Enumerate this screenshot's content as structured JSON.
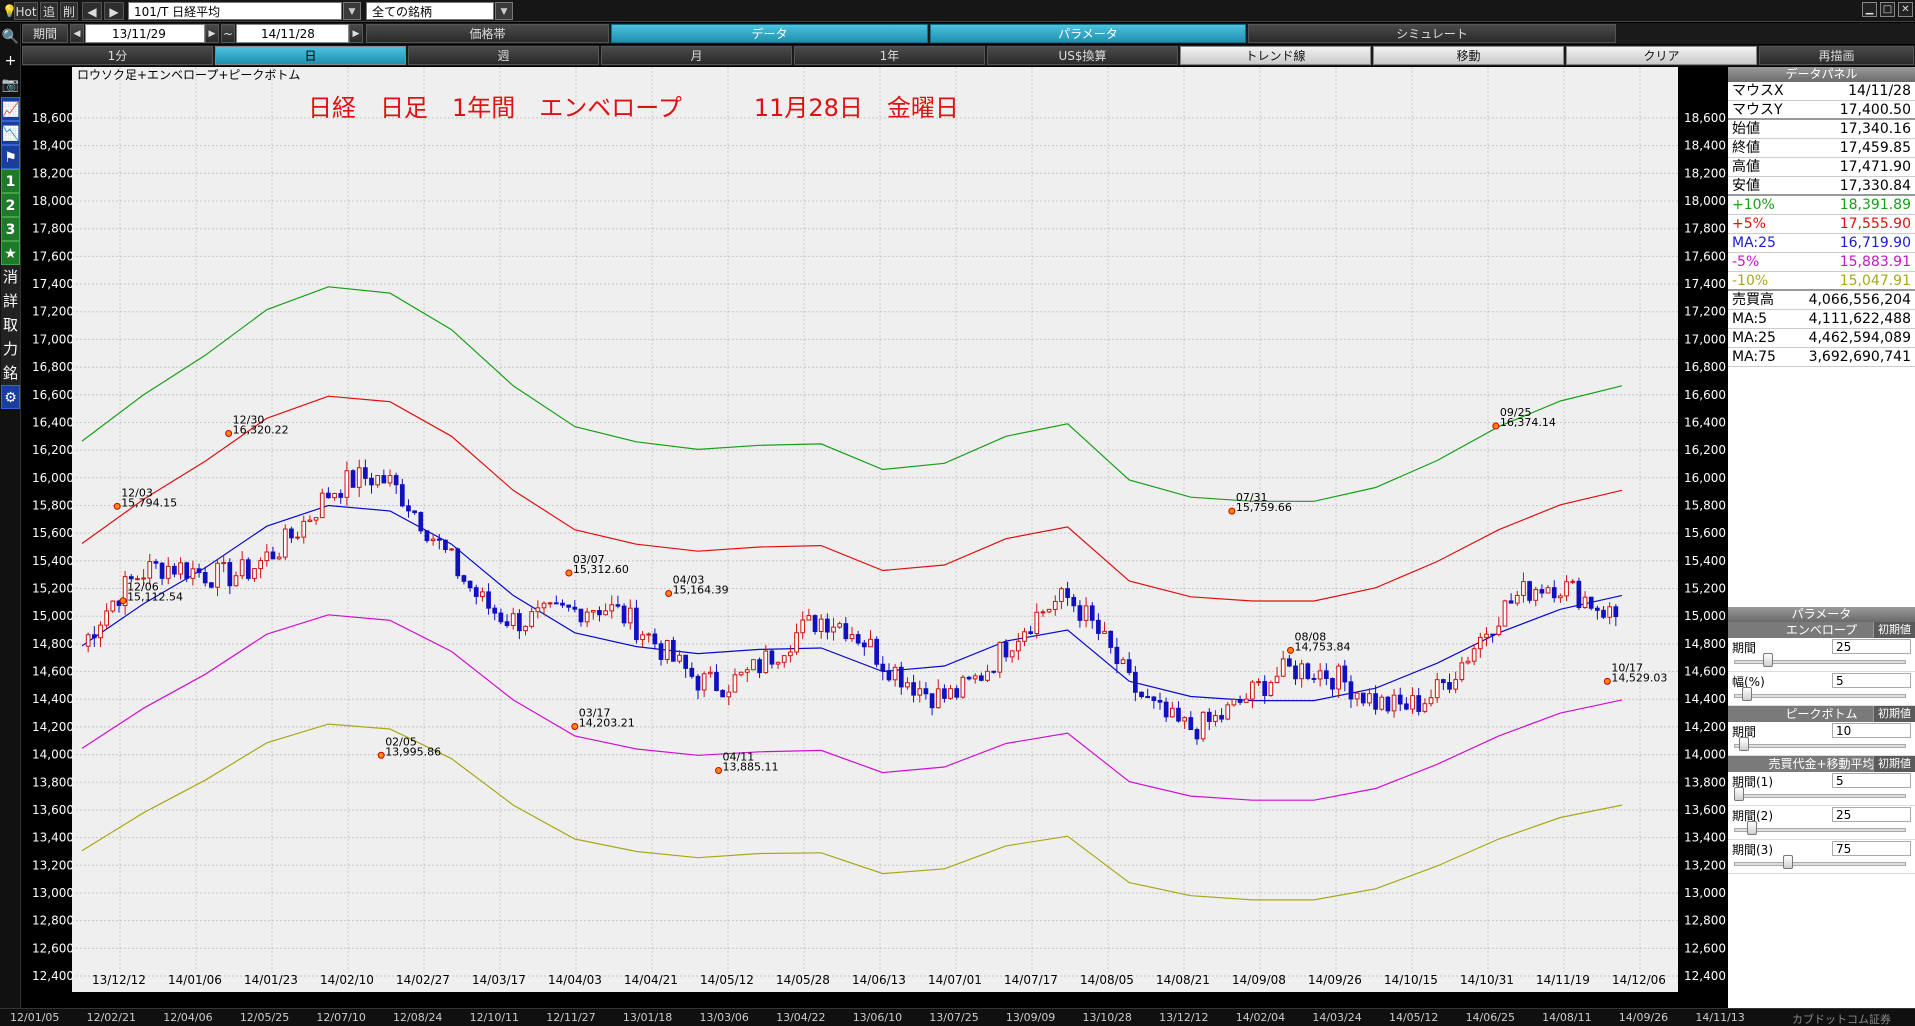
{
  "topbar": {
    "hot": "Hot",
    "tsui": "追",
    "sakujo": "削",
    "code": "101/T 日経平均",
    "market": "全ての銘柄"
  },
  "period": {
    "label": "期間",
    "start": "13/11/29",
    "sep": "~",
    "end": "14/11/28"
  },
  "row2_tabs": [
    {
      "label": "価格帯",
      "style": "dark"
    },
    {
      "label": "データ",
      "style": "blue"
    },
    {
      "label": "パラメータ",
      "style": "blue"
    },
    {
      "label": "シミュレート",
      "style": "dark"
    }
  ],
  "row3_tabs": [
    {
      "label": "1分",
      "style": "dark"
    },
    {
      "label": "日",
      "style": "sel"
    },
    {
      "label": "週",
      "style": "dark"
    },
    {
      "label": "月",
      "style": "dark"
    },
    {
      "label": "1年",
      "style": "dark"
    },
    {
      "label": "US$換算",
      "style": "dark"
    },
    {
      "label": "トレンド線",
      "style": "light"
    },
    {
      "label": "移動",
      "style": "light"
    },
    {
      "label": "クリア",
      "style": "light"
    },
    {
      "label": "再描画",
      "style": "dark"
    }
  ],
  "leftbar": [
    "🔍",
    "+",
    "📷",
    "📈",
    "📉",
    "⚑",
    "1",
    "2",
    "3",
    "★",
    "消",
    "詳",
    "取",
    "力",
    "銘",
    "⚙"
  ],
  "chart_data": {
    "type": "candlestick",
    "title": "日経　日足　1年間　エンベロープ　　　11月28日　金曜日",
    "subtitle": "ロウソク足+エンベロープ+ピークボトム",
    "ylim": [
      12400,
      18800
    ],
    "y_ticks": [
      "18,600",
      "18,400",
      "18,200",
      "18,000",
      "17,800",
      "17,600",
      "17,400",
      "17,200",
      "17,000",
      "16,800",
      "16,600",
      "16,400",
      "16,200",
      "16,000",
      "15,800",
      "15,600",
      "15,400",
      "15,200",
      "15,000",
      "14,800",
      "14,600",
      "14,400",
      "14,200",
      "14,000",
      "13,800",
      "13,600",
      "13,400",
      "13,200",
      "13,000",
      "12,800",
      "12,600",
      "12,400"
    ],
    "x_ticks": [
      "13/12/12",
      "14/01/06",
      "14/01/23",
      "14/02/10",
      "14/02/27",
      "14/03/17",
      "14/04/03",
      "14/04/21",
      "14/05/12",
      "14/05/28",
      "14/06/13",
      "14/07/01",
      "14/07/17",
      "14/08/05",
      "14/08/21",
      "14/09/08",
      "14/09/26",
      "14/10/15",
      "14/10/31",
      "14/11/19",
      "14/12/06"
    ],
    "series": [
      {
        "name": "MA:25",
        "color": "#0a0ad0",
        "x": [
          0,
          10,
          20,
          30,
          40,
          50,
          60,
          70,
          80,
          90,
          100,
          110,
          120,
          130,
          140,
          150,
          160,
          170,
          180,
          190,
          200,
          210,
          220,
          230,
          240,
          250
        ],
        "values": [
          14785,
          15090,
          15350,
          15650,
          15800,
          15760,
          15520,
          15150,
          14880,
          14780,
          14730,
          14760,
          14770,
          14600,
          14640,
          14820,
          14900,
          14530,
          14420,
          14390,
          14390,
          14480,
          14660,
          14880,
          15050,
          15150
        ]
      },
      {
        "name": "+5%",
        "color": "#e01010",
        "x": [
          0,
          10,
          20,
          30,
          40,
          50,
          60,
          70,
          80,
          90,
          100,
          110,
          120,
          130,
          140,
          150,
          160,
          170,
          180,
          190,
          200,
          210,
          220,
          230,
          240,
          250
        ],
        "values": [
          15525,
          15845,
          16120,
          16430,
          16590,
          16550,
          16300,
          15910,
          15625,
          15520,
          15470,
          15500,
          15510,
          15330,
          15370,
          15560,
          15645,
          15255,
          15140,
          15110,
          15110,
          15205,
          15395,
          15625,
          15805,
          15910
        ]
      },
      {
        "name": "+10%",
        "color": "#18a018",
        "x": [
          0,
          10,
          20,
          30,
          40,
          50,
          60,
          70,
          80,
          90,
          100,
          110,
          120,
          130,
          140,
          150,
          160,
          170,
          180,
          190,
          200,
          210,
          220,
          230,
          240,
          250
        ],
        "values": [
          16265,
          16600,
          16885,
          17215,
          17380,
          17335,
          17070,
          16665,
          16370,
          16260,
          16205,
          16235,
          16245,
          16060,
          16105,
          16300,
          16390,
          15985,
          15860,
          15830,
          15830,
          15930,
          16125,
          16370,
          16555,
          16665
        ]
      },
      {
        "name": "-5%",
        "color": "#d010d0",
        "x": [
          0,
          10,
          20,
          30,
          40,
          50,
          60,
          70,
          80,
          90,
          100,
          110,
          120,
          130,
          140,
          150,
          160,
          170,
          180,
          190,
          200,
          210,
          220,
          230,
          240,
          250
        ],
        "values": [
          14045,
          14335,
          14580,
          14870,
          15010,
          14970,
          14745,
          14395,
          14135,
          14040,
          13995,
          14020,
          14030,
          13870,
          13910,
          14080,
          14155,
          13805,
          13700,
          13670,
          13670,
          13755,
          13930,
          14135,
          14300,
          14395
        ]
      },
      {
        "name": "-10%",
        "color": "#a8a818",
        "x": [
          0,
          10,
          20,
          30,
          40,
          50,
          60,
          70,
          80,
          90,
          100,
          110,
          120,
          130,
          140,
          150,
          160,
          170,
          180,
          190,
          200,
          210,
          220,
          230,
          240,
          250
        ],
        "values": [
          13305,
          13580,
          13815,
          14085,
          14220,
          14185,
          13970,
          13635,
          13390,
          13300,
          13255,
          13285,
          13290,
          13140,
          13175,
          13340,
          13410,
          13075,
          12980,
          12950,
          12950,
          13030,
          13195,
          13390,
          13545,
          13635
        ]
      }
    ],
    "annotations": [
      {
        "date": "12/03",
        "value": "15,794.15"
      },
      {
        "date": "12/06",
        "value": "15,112.54"
      },
      {
        "date": "12/30",
        "value": "16,320.22"
      },
      {
        "date": "02/05",
        "value": "13,995.86"
      },
      {
        "date": "03/07",
        "value": "15,312.60"
      },
      {
        "date": "03/17",
        "value": "14,203.21"
      },
      {
        "date": "04/03",
        "value": "15,164.39"
      },
      {
        "date": "04/11",
        "value": "13,885.11"
      },
      {
        "date": "07/31",
        "value": "15,759.66"
      },
      {
        "date": "08/08",
        "value": "14,753.84"
      },
      {
        "date": "09/25",
        "value": "16,374.14"
      },
      {
        "date": "10/17",
        "value": "14,529.03"
      }
    ],
    "grid": true
  },
  "bottom_axis": [
    "12/01/05",
    "12/02/21",
    "12/04/06",
    "12/05/25",
    "12/07/10",
    "12/08/24",
    "12/10/11",
    "12/11/27",
    "13/01/18",
    "13/03/06",
    "13/04/22",
    "13/06/10",
    "13/07/25",
    "13/09/09",
    "13/10/28",
    "13/12/12",
    "14/02/04",
    "14/03/24",
    "14/05/12",
    "14/06/25",
    "14/08/11",
    "14/09/26",
    "14/11/13"
  ],
  "bottom_extra": "カブドットコム証券",
  "data_panel": {
    "title": "データパネル",
    "rows": [
      {
        "label": "マウスX",
        "value": "14/11/28",
        "color": "#000000"
      },
      {
        "label": "マウスY",
        "value": "17,400.50",
        "color": "#000000"
      },
      {
        "label": "始値",
        "value": "17,340.16",
        "color": "#000000"
      },
      {
        "label": "終値",
        "value": "17,459.85",
        "color": "#000000"
      },
      {
        "label": "高値",
        "value": "17,471.90",
        "color": "#000000"
      },
      {
        "label": "安値",
        "value": "17,330.84",
        "color": "#000000"
      },
      {
        "label": "+10%",
        "value": "18,391.89",
        "color": "#18a018"
      },
      {
        "label": "+5%",
        "value": "17,555.90",
        "color": "#e01010"
      },
      {
        "label": "MA:25",
        "value": "16,719.90",
        "color": "#1a1ad8"
      },
      {
        "label": "-5%",
        "value": "15,883.91",
        "color": "#d010d0"
      },
      {
        "label": "-10%",
        "value": "15,047.91",
        "color": "#a8a818"
      },
      {
        "label": "売買高",
        "value": "4,066,556,204",
        "color": "#000000"
      },
      {
        "label": "MA:5",
        "value": "4,111,622,488",
        "color": "#000000"
      },
      {
        "label": "MA:25",
        "value": "4,462,594,089",
        "color": "#000000"
      },
      {
        "label": "MA:75",
        "value": "3,692,690,741",
        "color": "#000000"
      }
    ]
  },
  "param_panel": {
    "title": "パラメータ",
    "reset": "初期値",
    "sections": [
      {
        "name": "エンベロープ",
        "params": [
          {
            "label": "期間",
            "value": "25",
            "level": 0.18
          },
          {
            "label": "幅(%)",
            "value": "5",
            "level": 0.05
          }
        ]
      },
      {
        "name": "ピークボトム",
        "params": [
          {
            "label": "期間",
            "value": "10",
            "level": 0.03
          }
        ]
      },
      {
        "name": "売買代金+移動平均",
        "params": [
          {
            "label": "期間(1)",
            "value": "5",
            "level": 0.0
          },
          {
            "label": "期間(2)",
            "value": "25",
            "level": 0.08
          },
          {
            "label": "期間(3)",
            "value": "75",
            "level": 0.3
          }
        ]
      }
    ]
  }
}
